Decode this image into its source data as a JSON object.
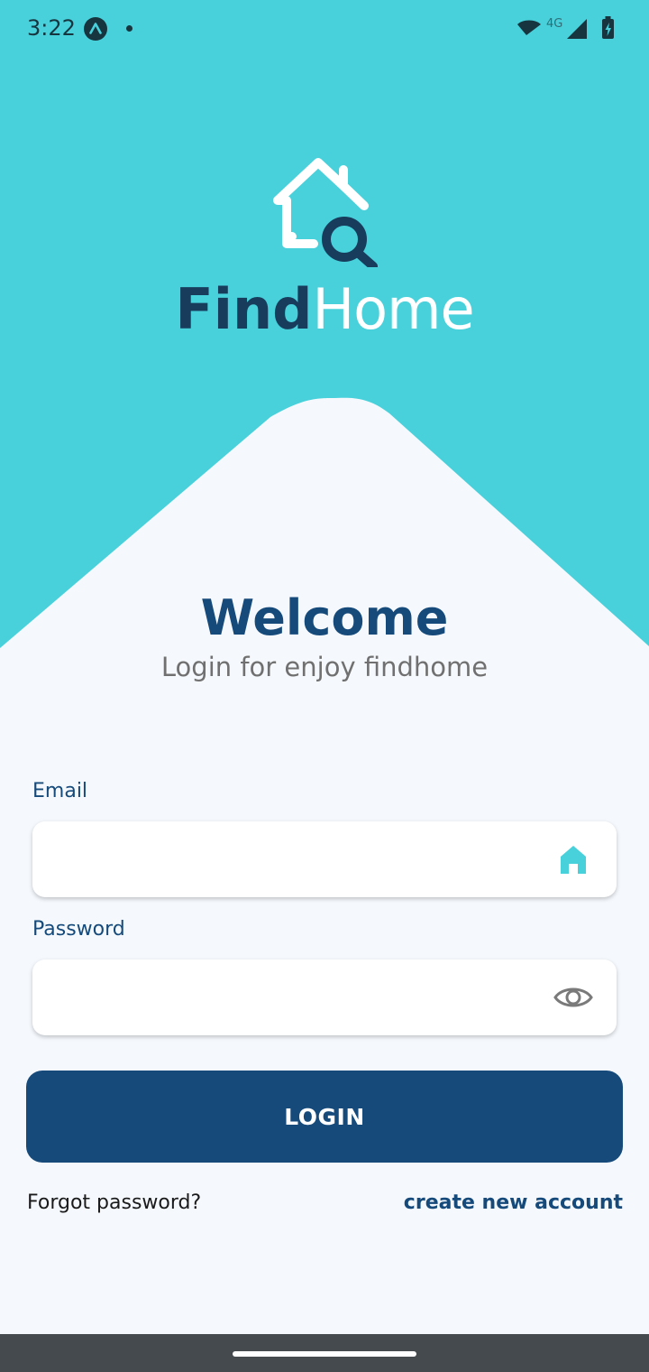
{
  "status_bar": {
    "time": "3:22",
    "network_label": "4G"
  },
  "brand": {
    "part1": "Find",
    "part2": "Home"
  },
  "welcome": {
    "title": "Welcome",
    "subtitle": "Login for enjoy findhome"
  },
  "form": {
    "email_label": "Email",
    "email_value": "",
    "password_label": "Password",
    "password_value": "",
    "login_label": "LOGIN"
  },
  "links": {
    "forgot": "Forgot password?",
    "create": "create new account"
  },
  "colors": {
    "accent": "#48d1db",
    "primary": "#164a7b",
    "background": "#f5f9fd"
  },
  "icons": {
    "email_field": "home-icon",
    "password_field": "eye-icon",
    "logo": "house-search-icon"
  }
}
